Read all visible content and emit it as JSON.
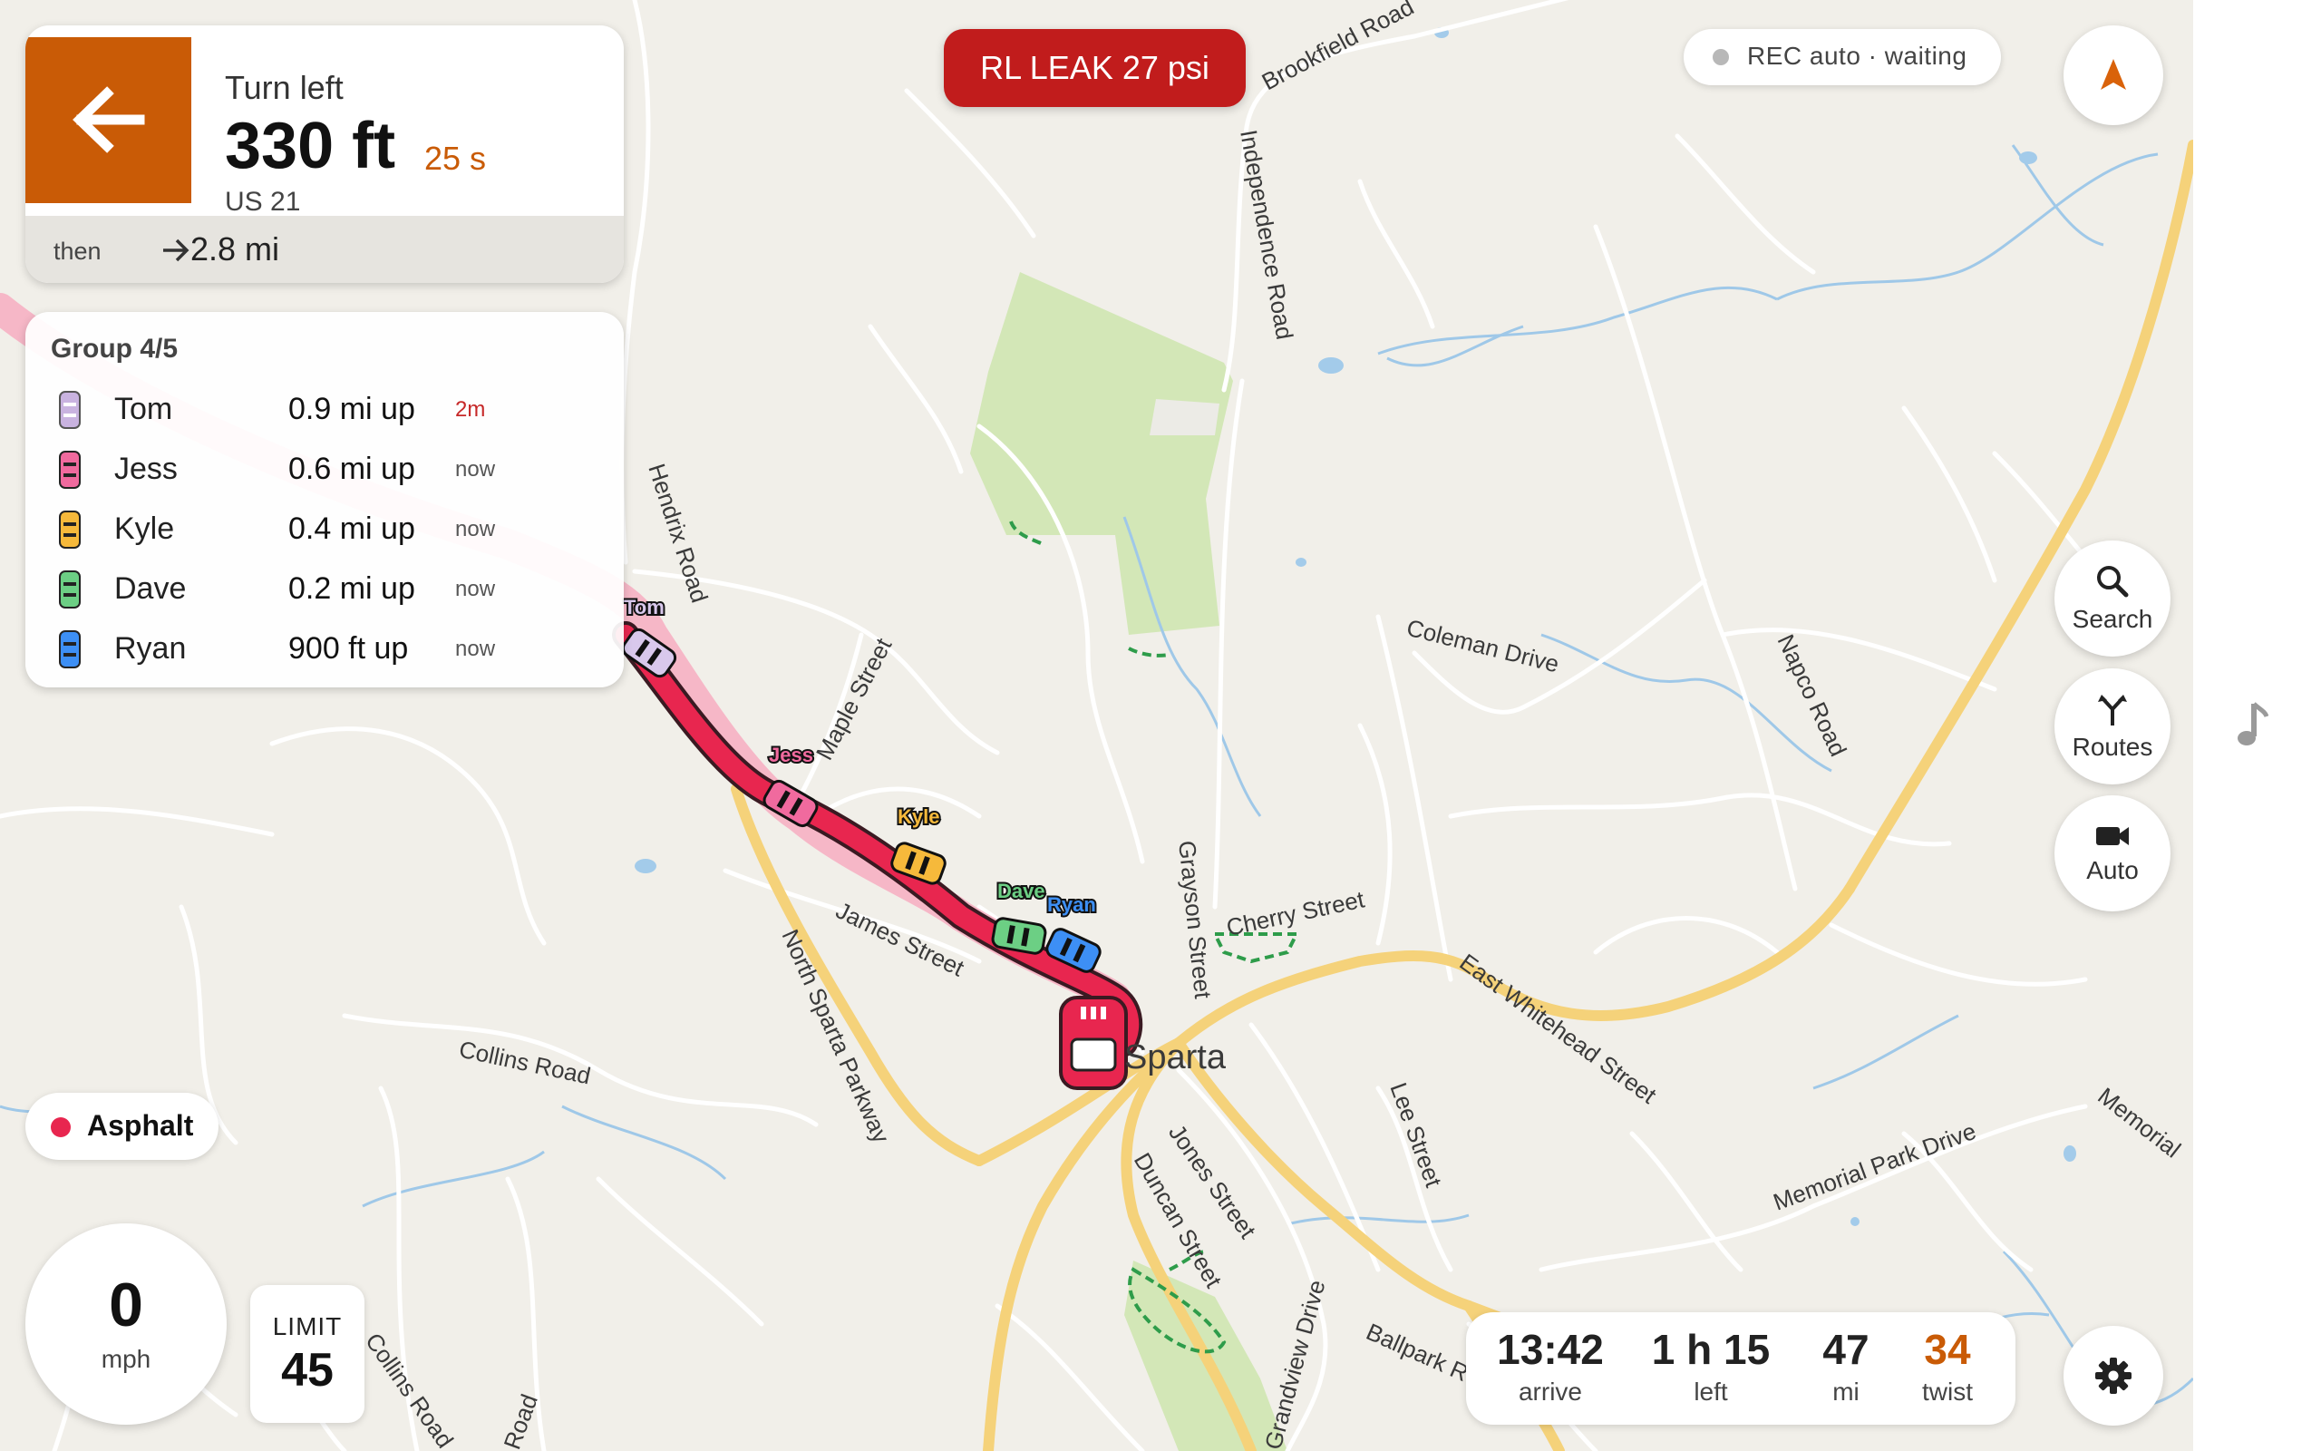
{
  "navigation": {
    "maneuver": "Turn left",
    "distance": "330 ft",
    "time": "25 s",
    "road": "US 21",
    "then_label": "then",
    "then_distance": "2.8 mi"
  },
  "group": {
    "header": "Group  4/5",
    "members": [
      {
        "name": "Tom",
        "distance": "0.9 mi up",
        "updated": "2m",
        "color": "#c9b3e0"
      },
      {
        "name": "Jess",
        "distance": "0.6 mi up",
        "updated": "now",
        "color": "#f06a9e"
      },
      {
        "name": "Kyle",
        "distance": "0.4 mi up",
        "updated": "now",
        "color": "#f6b93b"
      },
      {
        "name": "Dave",
        "distance": "0.2 mi up",
        "updated": "now",
        "color": "#6ccf84"
      },
      {
        "name": "Ryan",
        "distance": "900 ft up",
        "updated": "now",
        "color": "#3d8ff5"
      }
    ]
  },
  "alert": {
    "text": "RL LEAK 27 psi",
    "color": "#c11c1c"
  },
  "recording": {
    "status": "REC auto · waiting"
  },
  "buttons": {
    "search": "Search",
    "routes": "Routes",
    "auto": "Auto"
  },
  "surface": {
    "label": "Asphalt",
    "color": "#e8264f"
  },
  "speed": {
    "value": "0",
    "unit": "mph"
  },
  "limit": {
    "label": "LIMIT",
    "value": "45"
  },
  "trip": {
    "arrive_value": "13:42",
    "arrive_label": "arrive",
    "left_value": "1 h 15",
    "left_label": "left",
    "distance_value": "47",
    "distance_label": "mi",
    "twist_value": "34",
    "twist_label": "twist",
    "twist_color": "#c95b06"
  },
  "map": {
    "town": "Sparta",
    "streets": {
      "brookfield": "Brookfield Road",
      "independence": "Independence Road",
      "hendrix": "Hendrix Road",
      "maple": "Maple Street",
      "coleman": "Coleman Drive",
      "napco": "Napco Road",
      "grayson": "Grayson Street",
      "cherry": "Cherry Street",
      "james": "James Street",
      "north_sparta": "North Sparta Parkway",
      "collins1": "Collins Road",
      "collins2": "Collins Road",
      "east_whitehead": "East Whitehead Street",
      "lee": "Lee Street",
      "jones": "Jones Street",
      "duncan": "Duncan Street",
      "memorial_park": "Memorial Park Drive",
      "memorial": "Memorial",
      "grandview": "Grandview Drive",
      "ballpark": "Ballpark Ro",
      "road_frag": "Road"
    },
    "route_color": "#e8264f",
    "highway_color": "#f5d27a"
  }
}
